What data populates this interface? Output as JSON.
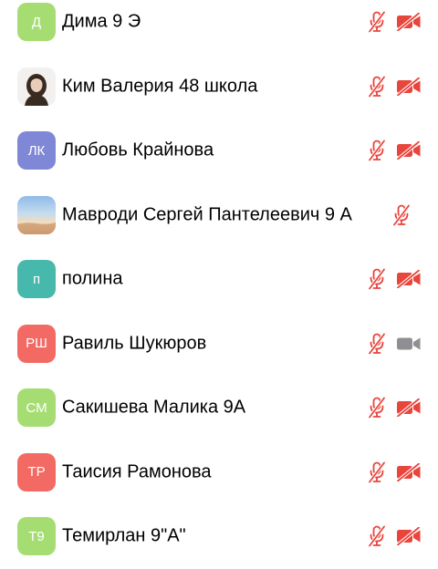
{
  "colors": {
    "muted_red": "#e8453c",
    "cam_gray": "#8e8e93",
    "avatar_green": "#a6dd73",
    "avatar_purple": "#7f88d6",
    "avatar_teal": "#47b8ac",
    "avatar_red": "#f26a63"
  },
  "participants": [
    {
      "initials": "Д",
      "name": "Дима 9 Э",
      "avatar_color": "#a6dd73",
      "avatar_kind": "initials",
      "mic": "muted",
      "camera": "off"
    },
    {
      "initials": "",
      "name": "Ким Валерия 48 школа",
      "avatar_color": "#f3f1ef",
      "avatar_kind": "photo-person",
      "mic": "muted",
      "camera": "off"
    },
    {
      "initials": "ЛК",
      "name": "Любовь Крайнова",
      "avatar_color": "#7f88d6",
      "avatar_kind": "initials",
      "mic": "muted",
      "camera": "off"
    },
    {
      "initials": "",
      "name": "Мавроди Сергей Пантелеевич 9 А",
      "avatar_color": "#bcd8ef",
      "avatar_kind": "photo-sky",
      "mic": "muted",
      "camera": "hidden"
    },
    {
      "initials": "п",
      "name": "полина",
      "avatar_color": "#47b8ac",
      "avatar_kind": "initials",
      "mic": "muted",
      "camera": "off"
    },
    {
      "initials": "РШ",
      "name": "Равиль Шукюров",
      "avatar_color": "#f26a63",
      "avatar_kind": "initials",
      "mic": "muted",
      "camera": "on"
    },
    {
      "initials": "СМ",
      "name": "Сакишева Малика 9А",
      "avatar_color": "#a6dd73",
      "avatar_kind": "initials",
      "mic": "muted",
      "camera": "off"
    },
    {
      "initials": "ТР",
      "name": "Таисия Рамонова",
      "avatar_color": "#f26a63",
      "avatar_kind": "initials",
      "mic": "muted",
      "camera": "off"
    },
    {
      "initials": "Т9",
      "name": "Темирлан 9\"А\"",
      "avatar_color": "#a6dd73",
      "avatar_kind": "initials",
      "mic": "muted",
      "camera": "off"
    }
  ]
}
